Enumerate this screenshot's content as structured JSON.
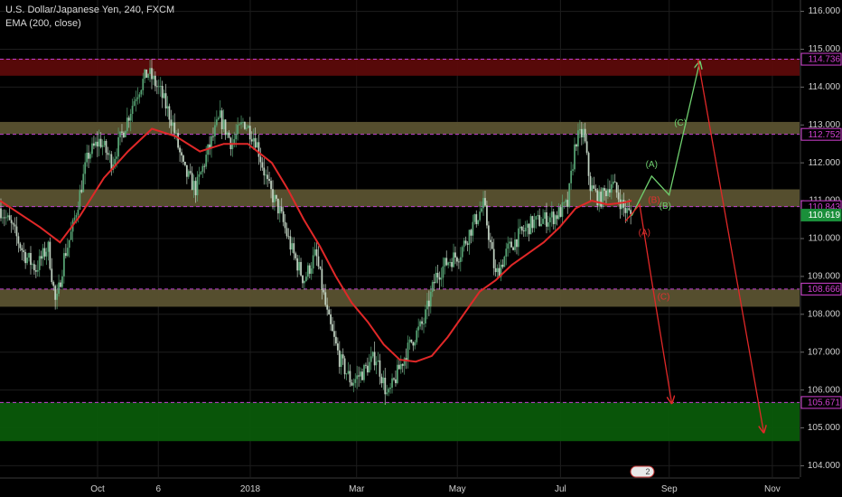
{
  "header": {
    "symbol_line": "U.S. Dollar/Japanese Yen, 240, FXCM",
    "indicator_line": "EMA (200, close)"
  },
  "chart_data": {
    "type": "candlestick",
    "ylim": [
      103.7,
      116.3
    ],
    "y_ticks": [
      "104.000",
      "105.000",
      "106.000",
      "107.000",
      "108.000",
      "109.000",
      "110.000",
      "111.000",
      "112.000",
      "113.000",
      "114.000",
      "115.000",
      "116.000"
    ],
    "x_ticks": [
      {
        "label": "Oct",
        "t": 0.122
      },
      {
        "label": "6",
        "t": 0.198
      },
      {
        "label": "2018",
        "t": 0.313
      },
      {
        "label": "Mar",
        "t": 0.446
      },
      {
        "label": "May",
        "t": 0.572
      },
      {
        "label": "Jul",
        "t": 0.701
      },
      {
        "label": "Sep",
        "t": 0.837
      },
      {
        "label": "Nov",
        "t": 0.966
      }
    ],
    "zones": [
      {
        "top": 114.75,
        "bottom": 114.3,
        "color": "#5c0a0a"
      },
      {
        "top": 113.08,
        "bottom": 112.76,
        "color": "#5a5230"
      },
      {
        "top": 111.3,
        "bottom": 110.84,
        "color": "#5a5230"
      },
      {
        "top": 108.66,
        "bottom": 108.2,
        "color": "#5a5230"
      },
      {
        "top": 105.67,
        "bottom": 104.65,
        "color": "#0a5a0a"
      }
    ],
    "levels": [
      114.736,
      112.752,
      110.845,
      108.666,
      105.671
    ],
    "price_tags": [
      {
        "label": "114.736",
        "value": 114.736,
        "bg": "#000000",
        "fg": "#d040d0"
      },
      {
        "label": "112.752",
        "value": 112.752,
        "bg": "#000000",
        "fg": "#d040d0"
      },
      {
        "label": "110.843",
        "value": 110.843,
        "bg": "#000000",
        "fg": "#d040d0"
      },
      {
        "label": "110.619",
        "value": 110.619,
        "bg": "#1a8f3a",
        "fg": "#ffffff"
      },
      {
        "label": "108.666",
        "value": 108.666,
        "bg": "#000000",
        "fg": "#d040d0"
      },
      {
        "label": "105.671",
        "value": 105.671,
        "bg": "#000000",
        "fg": "#d040d0"
      }
    ],
    "price_path": [
      [
        0.0,
        110.8
      ],
      [
        0.015,
        110.3
      ],
      [
        0.03,
        109.6
      ],
      [
        0.045,
        109.2
      ],
      [
        0.06,
        109.8
      ],
      [
        0.07,
        108.2
      ],
      [
        0.08,
        109.5
      ],
      [
        0.09,
        110.2
      ],
      [
        0.1,
        111.2
      ],
      [
        0.11,
        112.2
      ],
      [
        0.125,
        112.6
      ],
      [
        0.14,
        112.0
      ],
      [
        0.155,
        112.9
      ],
      [
        0.17,
        113.8
      ],
      [
        0.185,
        114.4
      ],
      [
        0.2,
        113.9
      ],
      [
        0.215,
        113.1
      ],
      [
        0.23,
        111.8
      ],
      [
        0.245,
        111.3
      ],
      [
        0.26,
        112.3
      ],
      [
        0.275,
        113.2
      ],
      [
        0.29,
        112.5
      ],
      [
        0.305,
        113.1
      ],
      [
        0.32,
        112.6
      ],
      [
        0.335,
        111.4
      ],
      [
        0.35,
        110.7
      ],
      [
        0.365,
        109.7
      ],
      [
        0.38,
        108.9
      ],
      [
        0.395,
        109.6
      ],
      [
        0.41,
        107.9
      ],
      [
        0.425,
        106.8
      ],
      [
        0.44,
        106.2
      ],
      [
        0.455,
        106.5
      ],
      [
        0.47,
        106.9
      ],
      [
        0.485,
        105.8
      ],
      [
        0.5,
        106.6
      ],
      [
        0.515,
        107.3
      ],
      [
        0.53,
        107.8
      ],
      [
        0.545,
        109.0
      ],
      [
        0.56,
        109.4
      ],
      [
        0.575,
        109.6
      ],
      [
        0.59,
        110.3
      ],
      [
        0.605,
        110.9
      ],
      [
        0.62,
        109.0
      ],
      [
        0.635,
        109.7
      ],
      [
        0.65,
        110.1
      ],
      [
        0.665,
        110.4
      ],
      [
        0.68,
        110.5
      ],
      [
        0.695,
        110.6
      ],
      [
        0.71,
        110.9
      ],
      [
        0.72,
        112.6
      ],
      [
        0.73,
        112.8
      ],
      [
        0.738,
        111.4
      ],
      [
        0.75,
        111.0
      ],
      [
        0.765,
        111.5
      ],
      [
        0.78,
        110.8
      ],
      [
        0.79,
        110.6
      ]
    ],
    "ema_path": [
      [
        0.0,
        111.0
      ],
      [
        0.05,
        110.3
      ],
      [
        0.075,
        109.9
      ],
      [
        0.1,
        110.6
      ],
      [
        0.13,
        111.6
      ],
      [
        0.16,
        112.3
      ],
      [
        0.19,
        112.9
      ],
      [
        0.22,
        112.7
      ],
      [
        0.25,
        112.3
      ],
      [
        0.28,
        112.5
      ],
      [
        0.31,
        112.5
      ],
      [
        0.34,
        112.0
      ],
      [
        0.36,
        111.3
      ],
      [
        0.38,
        110.5
      ],
      [
        0.4,
        109.8
      ],
      [
        0.42,
        109.0
      ],
      [
        0.44,
        108.3
      ],
      [
        0.46,
        107.8
      ],
      [
        0.48,
        107.2
      ],
      [
        0.5,
        106.8
      ],
      [
        0.52,
        106.75
      ],
      [
        0.54,
        106.9
      ],
      [
        0.56,
        107.4
      ],
      [
        0.58,
        108.0
      ],
      [
        0.6,
        108.6
      ],
      [
        0.62,
        108.9
      ],
      [
        0.64,
        109.3
      ],
      [
        0.66,
        109.6
      ],
      [
        0.68,
        109.9
      ],
      [
        0.7,
        110.3
      ],
      [
        0.72,
        110.8
      ],
      [
        0.74,
        111.0
      ],
      [
        0.76,
        110.9
      ],
      [
        0.78,
        110.95
      ],
      [
        0.79,
        111.0
      ]
    ],
    "green_path": [
      [
        0.79,
        110.6
      ],
      [
        0.815,
        111.65
      ],
      [
        0.837,
        111.15
      ],
      [
        0.875,
        114.65
      ]
    ],
    "red_path_1": [
      [
        0.782,
        110.45
      ],
      [
        0.8,
        110.9
      ],
      [
        0.815,
        108.9
      ],
      [
        0.84,
        105.67
      ]
    ],
    "red_path_2": [
      [
        0.873,
        114.72
      ],
      [
        0.955,
        104.9
      ]
    ],
    "wave_labels": [
      {
        "label": "(A)",
        "t": 0.815,
        "value": 111.95,
        "color": "#6fcf6f"
      },
      {
        "label": "(B)",
        "t": 0.832,
        "value": 110.85,
        "color": "#6fcf6f"
      },
      {
        "label": "(C)",
        "t": 0.851,
        "value": 113.05,
        "color": "#6fcf6f"
      },
      {
        "label": "(A)",
        "t": 0.806,
        "value": 110.15,
        "color": "#e03030"
      },
      {
        "label": "(B)",
        "t": 0.818,
        "value": 111.0,
        "color": "#e03030"
      },
      {
        "label": "(C)",
        "t": 0.83,
        "value": 108.45,
        "color": "#e03030"
      }
    ],
    "watermark_label": "2",
    "colors": {
      "price": "#4a9a6a",
      "ema": "#e02828",
      "level": "#c040d0",
      "green_arrow": "#6fcf6f",
      "red_arrow": "#e02828",
      "axis_text": "#cfcfcf",
      "grid": "#1d1d1d"
    }
  }
}
